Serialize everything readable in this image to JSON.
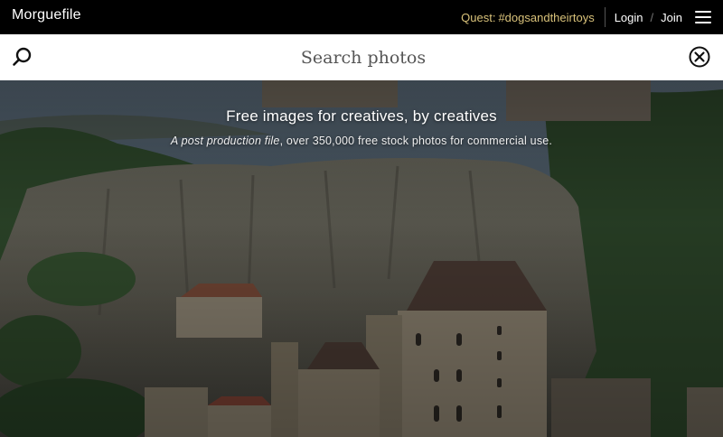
{
  "topbar": {
    "logo": "Morguefile",
    "quest_label": "Quest:",
    "quest_tag": "#dogsandtheirtoys",
    "login_label": "Login",
    "separator": "/",
    "join_label": "Join",
    "menu_icon": "hamburger-menu-icon"
  },
  "search": {
    "placeholder": "Search photos",
    "value": "",
    "search_icon": "search-icon",
    "clear_icon": "close-circle-icon"
  },
  "hero": {
    "title": "Free images for creatives, by creatives",
    "subtitle_em": "A post production file",
    "subtitle_rest": ", over 350,000 free stock photos for commercial use.",
    "image_description_icon": "hero-photo"
  },
  "colors": {
    "topbar_bg": "#000000",
    "quest_accent": "#d9c27a",
    "search_bg": "#ffffff"
  }
}
